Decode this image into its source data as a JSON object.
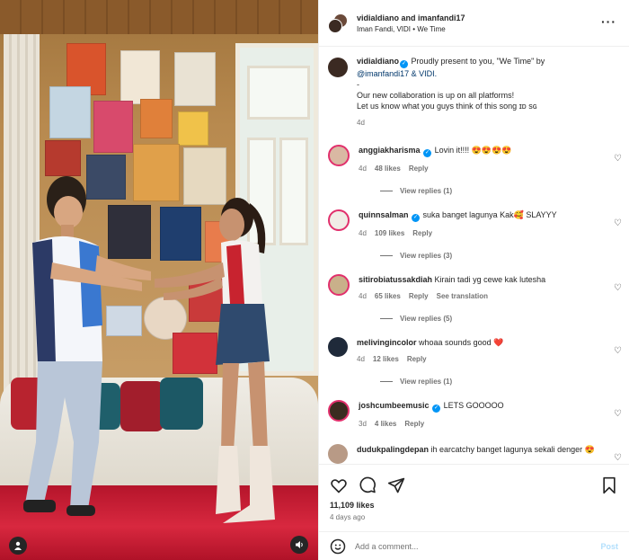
{
  "header": {
    "title": "vidialdiano and imanfandi17",
    "subtitle": "Iman Fandi, VIDI • We Time",
    "more_icon": "more-horizontal-icon"
  },
  "caption": {
    "username": "vidialdiano",
    "text_main": " Proudly present to you, \"We Time\" by",
    "text_mention": "@imanfandi17 & VIDI.",
    "dash": "-",
    "line_1": "Our new collaboration is up on all platforms!",
    "line_2": "Let us know what you guys think of this song ɪᴅ sɢ",
    "time": "4d"
  },
  "comments": [
    {
      "username": "anggiakharisma",
      "verified": true,
      "text": "Lovin it!!!! 😍😍😍😍",
      "time": "4d",
      "likes": "48 likes",
      "reply": "Reply",
      "extra": "",
      "replies": "View replies (1)"
    },
    {
      "username": "quinnsalman",
      "verified": true,
      "text": "suka banget lagunya Kak🥰 SLAYYY",
      "time": "4d",
      "likes": "109 likes",
      "reply": "Reply",
      "extra": "",
      "replies": "View replies (3)"
    },
    {
      "username": "sitirobiatussakdiah",
      "verified": false,
      "text": "Kirain tadi yg cewe kak lutesha",
      "time": "4d",
      "likes": "65 likes",
      "reply": "Reply",
      "extra": "See translation",
      "replies": "View replies (5)"
    },
    {
      "username": "melivingincolor",
      "verified": false,
      "text": "whoaa sounds good ❤️",
      "time": "4d",
      "likes": "12 likes",
      "reply": "Reply",
      "extra": "",
      "replies": "View replies (1)"
    },
    {
      "username": "joshcumbeemusic",
      "verified": true,
      "text": "LETS GOOOOO",
      "time": "3d",
      "likes": "4 likes",
      "reply": "Reply",
      "extra": "",
      "replies": ""
    },
    {
      "username": "dudukpalingdepan",
      "verified": false,
      "text": "ih earcatchy banget lagunya sekali denger 😍",
      "time": "",
      "likes": "",
      "reply": "",
      "extra": "",
      "replies": ""
    }
  ],
  "actions": {
    "like_icon": "heart-icon",
    "comment_icon": "comment-icon",
    "share_icon": "send-icon",
    "save_icon": "bookmark-icon"
  },
  "likes": "11,109 likes",
  "date": "4 days ago",
  "add_comment": {
    "placeholder": "Add a comment...",
    "post_label": "Post",
    "emoji_icon": "smiley-icon"
  },
  "media": {
    "user_icon": "user-tag-icon",
    "audio_icon": "volume-icon"
  },
  "colors": {
    "verified": "#0095f6",
    "muted_text": "#737373",
    "post_disabled": "#b2dffc",
    "floor_red": "#d8283f"
  }
}
